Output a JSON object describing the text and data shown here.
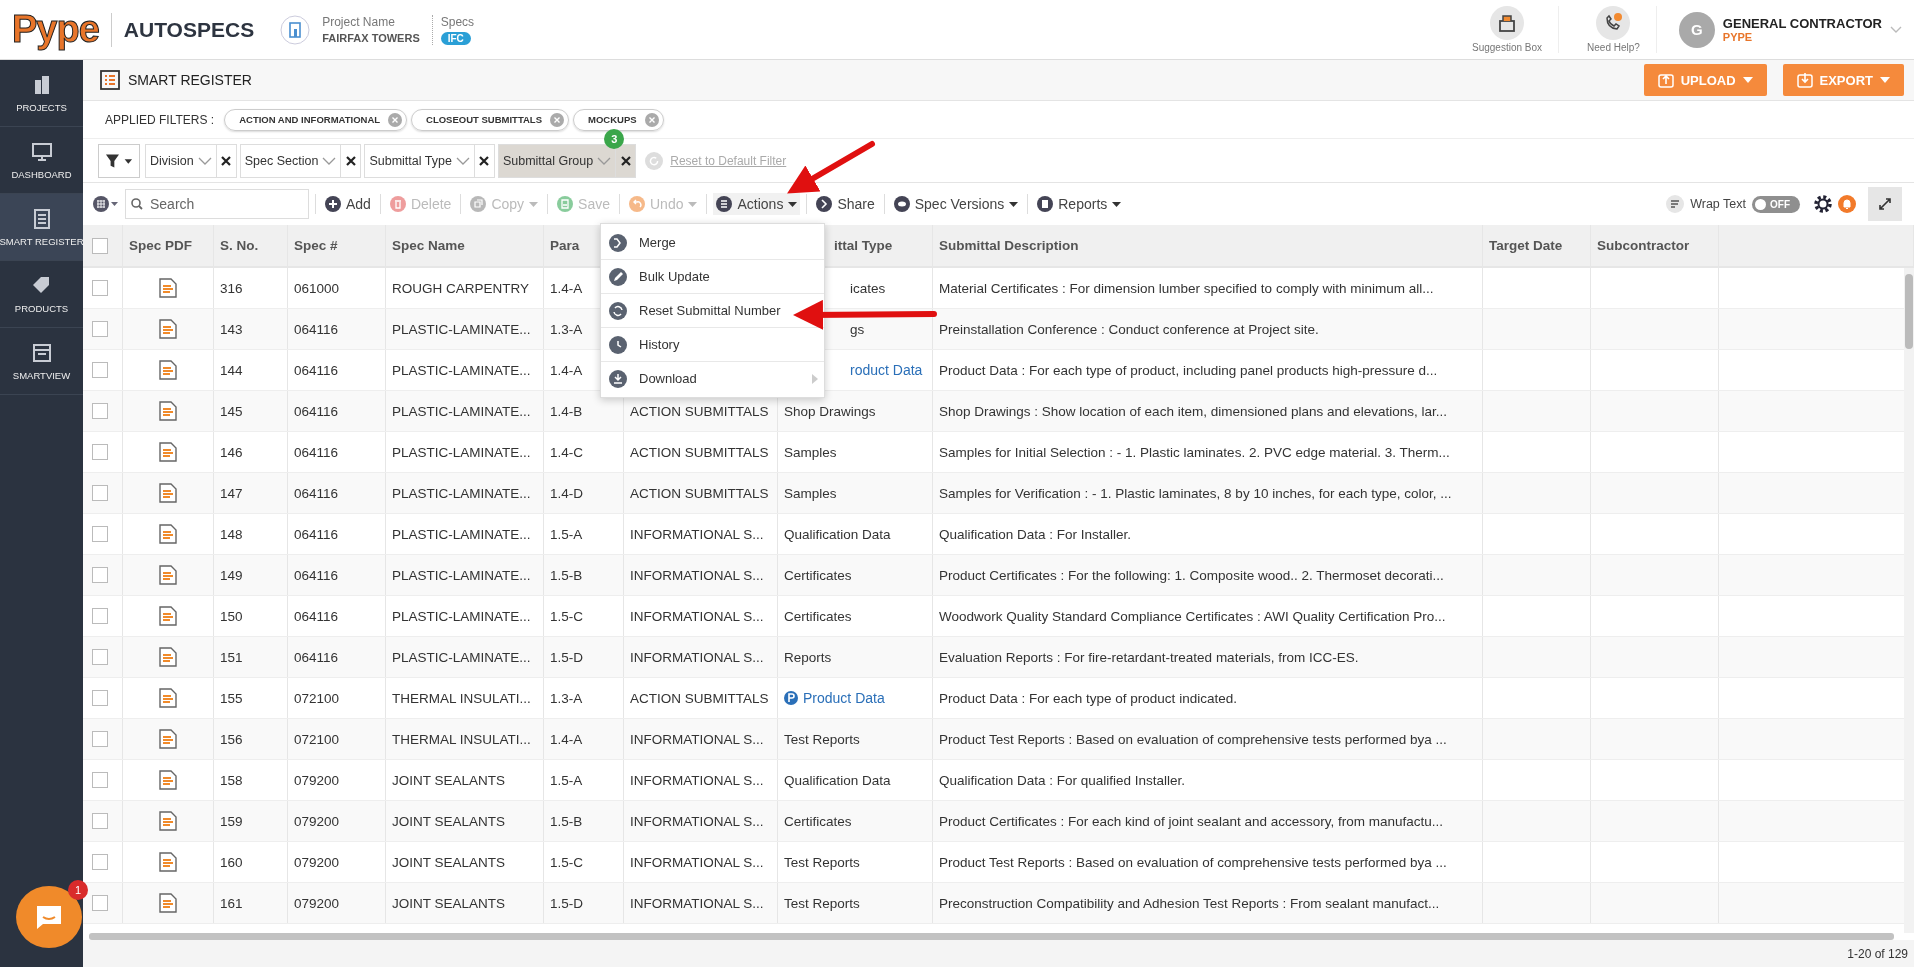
{
  "header": {
    "logo": "Pype",
    "product": "AUTOSPECS",
    "project_label": "Project Name",
    "project": "FAIRFAX TOWERS",
    "specs_label": "Specs",
    "specs": "IFC",
    "links": [
      {
        "label": "Suggestion Box"
      },
      {
        "label": "Need Help?"
      }
    ],
    "user": {
      "initial": "G",
      "name": "GENERAL CONTRACTOR",
      "company": "PYPE"
    }
  },
  "sidebar": {
    "items": [
      {
        "label": "PROJECTS",
        "selected": false
      },
      {
        "label": "DASHBOARD",
        "selected": false
      },
      {
        "label": "SMART REGISTER",
        "selected": true
      },
      {
        "label": "PRODUCTS",
        "selected": false
      },
      {
        "label": "SMARTVIEW",
        "selected": false
      }
    ]
  },
  "chat": {
    "badge": "1"
  },
  "page": {
    "title": "SMART REGISTER",
    "buttons": [
      {
        "label": "UPLOAD"
      },
      {
        "label": "EXPORT"
      }
    ]
  },
  "applied_filters": {
    "label": "APPLIED FILTERS :",
    "chips": [
      "ACTION AND INFORMATIONAL",
      "CLOSEOUT SUBMITTALS",
      "MOCKUPS"
    ]
  },
  "filters": {
    "fields": [
      {
        "label": "Division",
        "selected": false
      },
      {
        "label": "Spec Section",
        "selected": false
      },
      {
        "label": "Submittal Type",
        "selected": false
      },
      {
        "label": "Submittal Group",
        "selected": true,
        "badge": "3"
      }
    ],
    "reset": "Reset to Default Filter"
  },
  "toolbar": {
    "search": {
      "placeholder": "Search"
    },
    "items": [
      {
        "label": "Add",
        "disabled": false,
        "caret": false
      },
      {
        "label": "Delete",
        "disabled": true,
        "caret": false
      },
      {
        "label": "Copy",
        "disabled": true,
        "caret": true
      },
      {
        "label": "Save",
        "disabled": true,
        "caret": false
      },
      {
        "label": "Undo",
        "disabled": true,
        "caret": true
      },
      {
        "label": "Actions",
        "disabled": false,
        "caret": true,
        "open": true,
        "menu": [
          {
            "label": "Merge",
            "submenu": false
          },
          {
            "label": "Bulk Update",
            "submenu": false
          },
          {
            "label": "Reset Submittal Number",
            "submenu": false
          },
          {
            "label": "History",
            "submenu": false
          },
          {
            "label": "Download",
            "submenu": true
          }
        ]
      },
      {
        "label": "Share",
        "disabled": false,
        "caret": false
      },
      {
        "label": "Spec Versions",
        "disabled": false,
        "caret": true
      },
      {
        "label": "Reports",
        "disabled": false,
        "caret": true
      }
    ],
    "wrap_text": {
      "label": "Wrap Text",
      "on": false,
      "state": "OFF"
    }
  },
  "table": {
    "all_checked": false,
    "columns": [
      {
        "label": "Spec PDF",
        "covered": false
      },
      {
        "label": "S. No.",
        "covered": false
      },
      {
        "label": "Spec #",
        "covered": false
      },
      {
        "label": "Spec Name",
        "covered": false
      },
      {
        "label": "Para",
        "covered": false
      },
      {
        "label": "ittal Type",
        "covered": true
      },
      {
        "label": "Submittal Description",
        "covered": false
      },
      {
        "label": "Target Date",
        "covered": false
      },
      {
        "label": "Subcontractor",
        "covered": false
      }
    ],
    "rows": [
      {
        "checked": false,
        "covered": true,
        "sno": "316",
        "spec": "061000",
        "name": "ROUGH CARPENTRY",
        "para": "1.4-A",
        "type": "icates",
        "type_link": false,
        "desc": "Material Certificates : For dimension lumber specified to comply with minimum all..."
      },
      {
        "checked": false,
        "covered": true,
        "sno": "143",
        "spec": "064116",
        "name": "PLASTIC-LAMINATE...",
        "para": "1.3-A",
        "type": "gs",
        "type_link": false,
        "desc": "Preinstallation Conference : Conduct conference at Project site."
      },
      {
        "checked": false,
        "covered": true,
        "sno": "144",
        "spec": "064116",
        "name": "PLASTIC-LAMINATE...",
        "para": "1.4-A",
        "type": "roduct Data",
        "type_link": true,
        "desc": "Product Data : For each type of product, including panel products high-pressure d..."
      },
      {
        "checked": false,
        "covered": false,
        "sno": "145",
        "spec": "064116",
        "name": "PLASTIC-LAMINATE...",
        "para": "1.4-B",
        "group": "ACTION SUBMITTALS",
        "type": "Shop Drawings",
        "type_link": false,
        "desc": "Shop Drawings : Show location of each item, dimensioned plans and elevations, lar..."
      },
      {
        "checked": false,
        "covered": false,
        "sno": "146",
        "spec": "064116",
        "name": "PLASTIC-LAMINATE...",
        "para": "1.4-C",
        "group": "ACTION SUBMITTALS",
        "type": "Samples",
        "type_link": false,
        "desc": "Samples for Initial Selection : - 1. Plastic laminates. 2. PVC edge material. 3. Therm..."
      },
      {
        "checked": false,
        "covered": false,
        "sno": "147",
        "spec": "064116",
        "name": "PLASTIC-LAMINATE...",
        "para": "1.4-D",
        "group": "ACTION SUBMITTALS",
        "type": "Samples",
        "type_link": false,
        "desc": "Samples for Verification : - 1. Plastic laminates, 8 by 10 inches, for each type, color, ..."
      },
      {
        "checked": false,
        "covered": false,
        "sno": "148",
        "spec": "064116",
        "name": "PLASTIC-LAMINATE...",
        "para": "1.5-A",
        "group": "INFORMATIONAL S...",
        "type": "Qualification Data",
        "type_link": false,
        "desc": "Qualification Data : For Installer."
      },
      {
        "checked": false,
        "covered": false,
        "sno": "149",
        "spec": "064116",
        "name": "PLASTIC-LAMINATE...",
        "para": "1.5-B",
        "group": "INFORMATIONAL S...",
        "type": "Certificates",
        "type_link": false,
        "desc": "Product Certificates : For the following: 1. Composite wood.. 2. Thermoset decorati..."
      },
      {
        "checked": false,
        "covered": false,
        "sno": "150",
        "spec": "064116",
        "name": "PLASTIC-LAMINATE...",
        "para": "1.5-C",
        "group": "INFORMATIONAL S...",
        "type": "Certificates",
        "type_link": false,
        "desc": "Woodwork Quality Standard Compliance Certificates : AWI Quality Certification Pro..."
      },
      {
        "checked": false,
        "covered": false,
        "sno": "151",
        "spec": "064116",
        "name": "PLASTIC-LAMINATE...",
        "para": "1.5-D",
        "group": "INFORMATIONAL S...",
        "type": "Reports",
        "type_link": false,
        "desc": "Evaluation Reports : For fire-retardant-treated materials, from ICC-ES."
      },
      {
        "checked": false,
        "covered": false,
        "sno": "155",
        "spec": "072100",
        "name": "THERMAL INSULATI...",
        "para": "1.3-A",
        "group": "ACTION SUBMITTALS",
        "type": "Product Data",
        "type_link": true,
        "desc": "Product Data : For each type of product indicated."
      },
      {
        "checked": false,
        "covered": false,
        "sno": "156",
        "spec": "072100",
        "name": "THERMAL INSULATI...",
        "para": "1.4-A",
        "group": "INFORMATIONAL S...",
        "type": "Test Reports",
        "type_link": false,
        "desc": "Product Test Reports : Based on evaluation of comprehensive tests performed bya ..."
      },
      {
        "checked": false,
        "covered": false,
        "sno": "158",
        "spec": "079200",
        "name": "JOINT SEALANTS",
        "para": "1.5-A",
        "group": "INFORMATIONAL S...",
        "type": "Qualification Data",
        "type_link": false,
        "desc": "Qualification Data : For qualified Installer."
      },
      {
        "checked": false,
        "covered": false,
        "sno": "159",
        "spec": "079200",
        "name": "JOINT SEALANTS",
        "para": "1.5-B",
        "group": "INFORMATIONAL S...",
        "type": "Certificates",
        "type_link": false,
        "desc": "Product Certificates : For each kind of joint sealant and accessory, from manufactu..."
      },
      {
        "checked": false,
        "covered": false,
        "sno": "160",
        "spec": "079200",
        "name": "JOINT SEALANTS",
        "para": "1.5-C",
        "group": "INFORMATIONAL S...",
        "type": "Test Reports",
        "type_link": false,
        "desc": "Product Test Reports : Based on evaluation of comprehensive tests performed bya ..."
      },
      {
        "checked": false,
        "covered": false,
        "sno": "161",
        "spec": "079200",
        "name": "JOINT SEALANTS",
        "para": "1.5-D",
        "group": "INFORMATIONAL S...",
        "type": "Test Reports",
        "type_link": false,
        "desc": "Preconstruction Compatibility and Adhesion Test Reports : From sealant manufact..."
      }
    ],
    "pager": "1-20 of 129"
  }
}
